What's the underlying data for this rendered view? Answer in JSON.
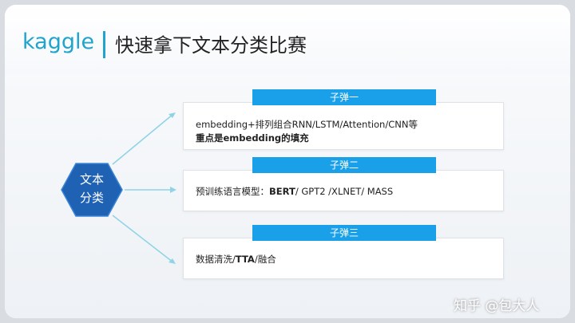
{
  "header": {
    "logo_text": "kaggle",
    "title": "快速拿下文本分类比赛"
  },
  "center": {
    "line1": "文本",
    "line2": "分类"
  },
  "sections": [
    {
      "tag": "子弹一",
      "line1": "embedding+排列组合RNN/LSTM/Attention/CNN等",
      "line2": "重点是embedding的填充"
    },
    {
      "tag": "子弹二",
      "prefix": "预训练语言模型：",
      "bold": "BERT",
      "suffix": "/ GPT2 /XLNET/ MASS"
    },
    {
      "tag": "子弹三",
      "prefix": "数据清洗/",
      "bold": "TTA",
      "suffix": "/融合"
    }
  ],
  "watermark": "知乎 @包大人",
  "colors": {
    "accent": "#20a4cc",
    "tag_blue": "#1aa0e8",
    "hex_blue": "#1f62b4",
    "arrow": "#8fd3e6"
  }
}
